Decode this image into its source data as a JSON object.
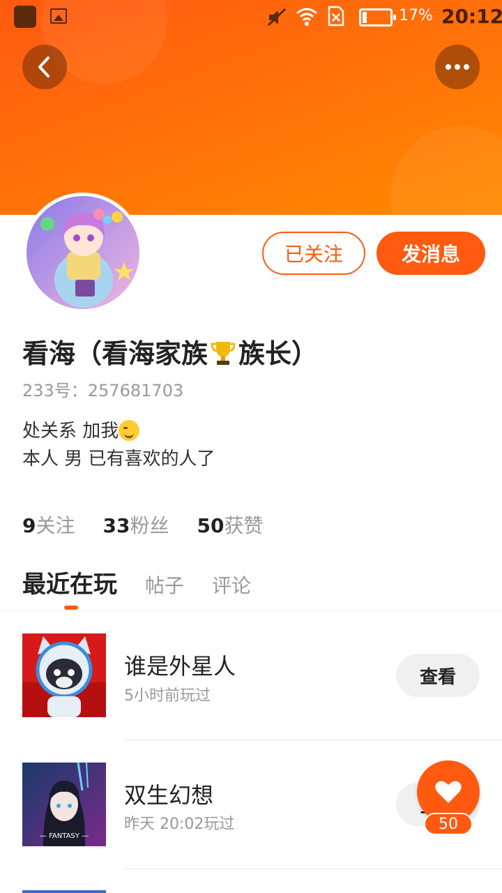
{
  "status_bar": {
    "battery_percent": "17%",
    "battery_level": 0.17,
    "time": "20:12"
  },
  "header": {
    "back_icon": "chevron-left-icon",
    "more_icon": "more-dots-icon"
  },
  "profile": {
    "nickname_prefix": "看海（看海家族",
    "nickname_suffix": "族长）",
    "uid": "233号：257681703",
    "bio_line1": "处关系  加我",
    "bio_line2": "本人  男  已有喜欢的人了",
    "follow_button": "已关注",
    "message_button": "发消息"
  },
  "stats": [
    {
      "num": "9",
      "label": "关注"
    },
    {
      "num": "33",
      "label": "粉丝"
    },
    {
      "num": "50",
      "label": "获赞"
    }
  ],
  "tabs": {
    "active": "最近在玩",
    "t2": "帖子",
    "t3": "评论"
  },
  "games": [
    {
      "name": "谁是外星人",
      "played": "5小时前玩过",
      "button": "查看"
    },
    {
      "name": "双生幻想",
      "played": "昨天 20:02玩过",
      "button": "查看",
      "thumb_text": "— FANTASY —"
    }
  ],
  "like": {
    "count": "50"
  },
  "colors": {
    "accent": "#ff5a10",
    "banner": "#ff6f0a"
  }
}
